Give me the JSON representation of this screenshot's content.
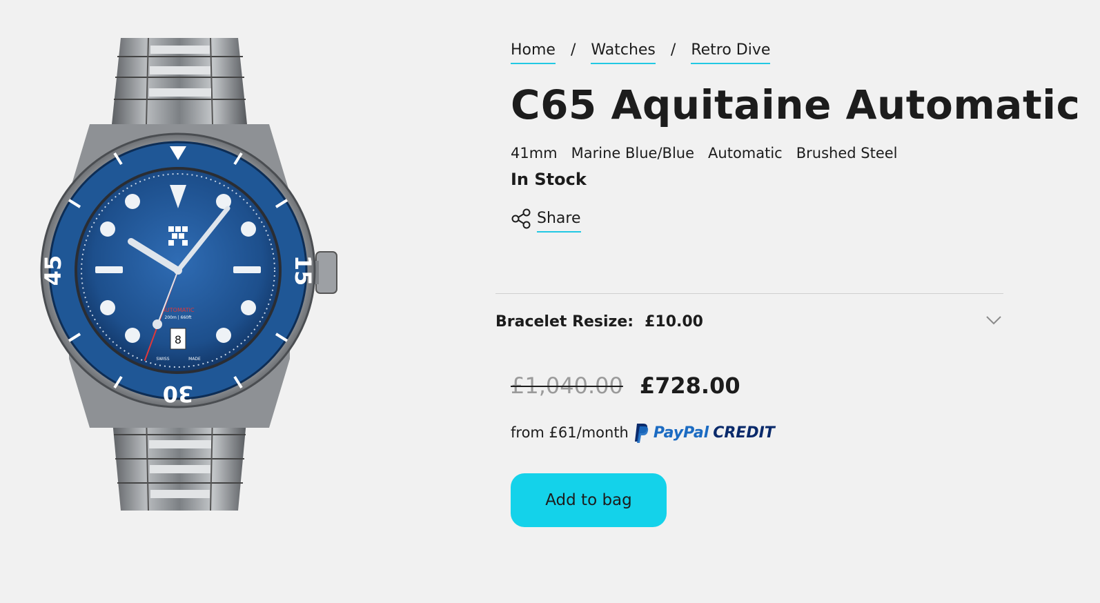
{
  "breadcrumb": {
    "items": [
      "Home",
      "Watches",
      "Retro Dive"
    ],
    "separator": "/"
  },
  "product": {
    "title": "C65 Aquitaine Automatic",
    "specs": [
      "41mm",
      "Marine Blue/Blue",
      "Automatic",
      "Brushed Steel"
    ],
    "stock": "In Stock",
    "dial_text": {
      "automatic": "AUTOMATIC",
      "depth": "200m | 660ft",
      "swiss": "SWISS",
      "made": "MADE",
      "date": "8"
    },
    "bezel_numbers": [
      "15",
      "30",
      "45"
    ]
  },
  "share": {
    "label": "Share",
    "icon": "share-icon"
  },
  "option": {
    "label": "Bracelet Resize:",
    "price": "£10.00",
    "icon": "chevron-down-icon"
  },
  "pricing": {
    "old_price": "£1,040.00",
    "new_price": "£728.00"
  },
  "finance": {
    "text": "from £61/month",
    "paypal": "PayPal",
    "credit": "CREDIT"
  },
  "cta": {
    "label": "Add to bag"
  },
  "colors": {
    "accent": "#14d2ea",
    "underline": "#21c8e3",
    "background": "#f1f1f1",
    "dial": "#1d4f8c",
    "paypal_light": "#1b6bc2",
    "paypal_dark": "#0a2a6b"
  }
}
